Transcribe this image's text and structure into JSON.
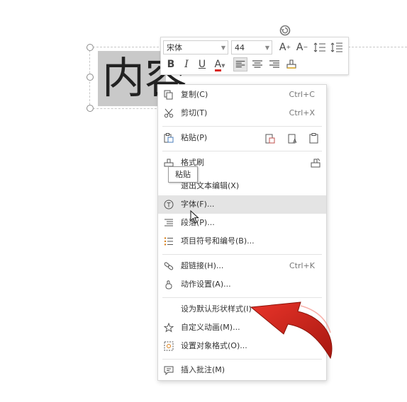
{
  "slide": {
    "text_content": "内容"
  },
  "toolbar": {
    "font_name": "宋体",
    "font_size": "44",
    "increase_font_label": "A",
    "decrease_font_label": "A",
    "bold_label": "B",
    "italic_label": "I",
    "underline_label": "U",
    "font_color_label": "A"
  },
  "context_menu": {
    "items": [
      {
        "label": "复制(C)",
        "shortcut": "Ctrl+C",
        "icon": "copy-icon"
      },
      {
        "label": "剪切(T)",
        "shortcut": "Ctrl+X",
        "icon": "cut-icon"
      },
      {
        "label": "粘贴(P)",
        "shortcut": "",
        "icon": "paste-icon"
      },
      {
        "label": "格式刷",
        "shortcut": "",
        "icon": "format-painter-icon"
      },
      {
        "label": "退出文本编辑(X)",
        "shortcut": "",
        "icon": ""
      },
      {
        "label": "字体(F)...",
        "shortcut": "",
        "icon": "font-icon"
      },
      {
        "label": "段落(P)...",
        "shortcut": "",
        "icon": "paragraph-icon"
      },
      {
        "label": "项目符号和编号(B)...",
        "shortcut": "",
        "icon": "bullets-icon"
      },
      {
        "label": "超链接(H)...",
        "shortcut": "Ctrl+K",
        "icon": "hyperlink-icon"
      },
      {
        "label": "动作设置(A)...",
        "shortcut": "",
        "icon": "action-icon"
      },
      {
        "label": "设为默认形状样式(I)",
        "shortcut": "",
        "icon": ""
      },
      {
        "label": "自定义动画(M)...",
        "shortcut": "",
        "icon": "custom-animation-icon"
      },
      {
        "label": "设置对象格式(O)...",
        "shortcut": "",
        "icon": "format-object-icon"
      },
      {
        "label": "插入批注(M)",
        "shortcut": "",
        "icon": "insert-comment-icon"
      }
    ],
    "hovered_index": 5
  },
  "tooltip": {
    "text": "粘贴"
  },
  "colors": {
    "annotation_arrow": "#cc2418",
    "font_color_bar": "#d9261c",
    "hover_bg": "#e4e4e4",
    "text_highlight": "#c9c9c9"
  }
}
